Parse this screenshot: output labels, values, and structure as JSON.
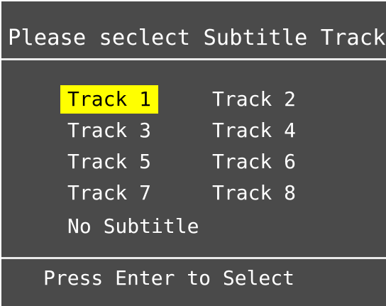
{
  "dialog": {
    "title": "Please seclect Subtitle Track:",
    "options": [
      "Track 1",
      "Track 2",
      "Track 3",
      "Track 4",
      "Track 5",
      "Track 6",
      "Track 7",
      "Track 8",
      "No Subtitle"
    ],
    "selected_option": "Track 1",
    "footer": "Press Enter to Select"
  },
  "colors": {
    "background": "#4a4a4a",
    "text": "#ffffff",
    "highlight": "#ffff00",
    "highlight_text": "#000000",
    "divider": "#e9e9e9"
  }
}
